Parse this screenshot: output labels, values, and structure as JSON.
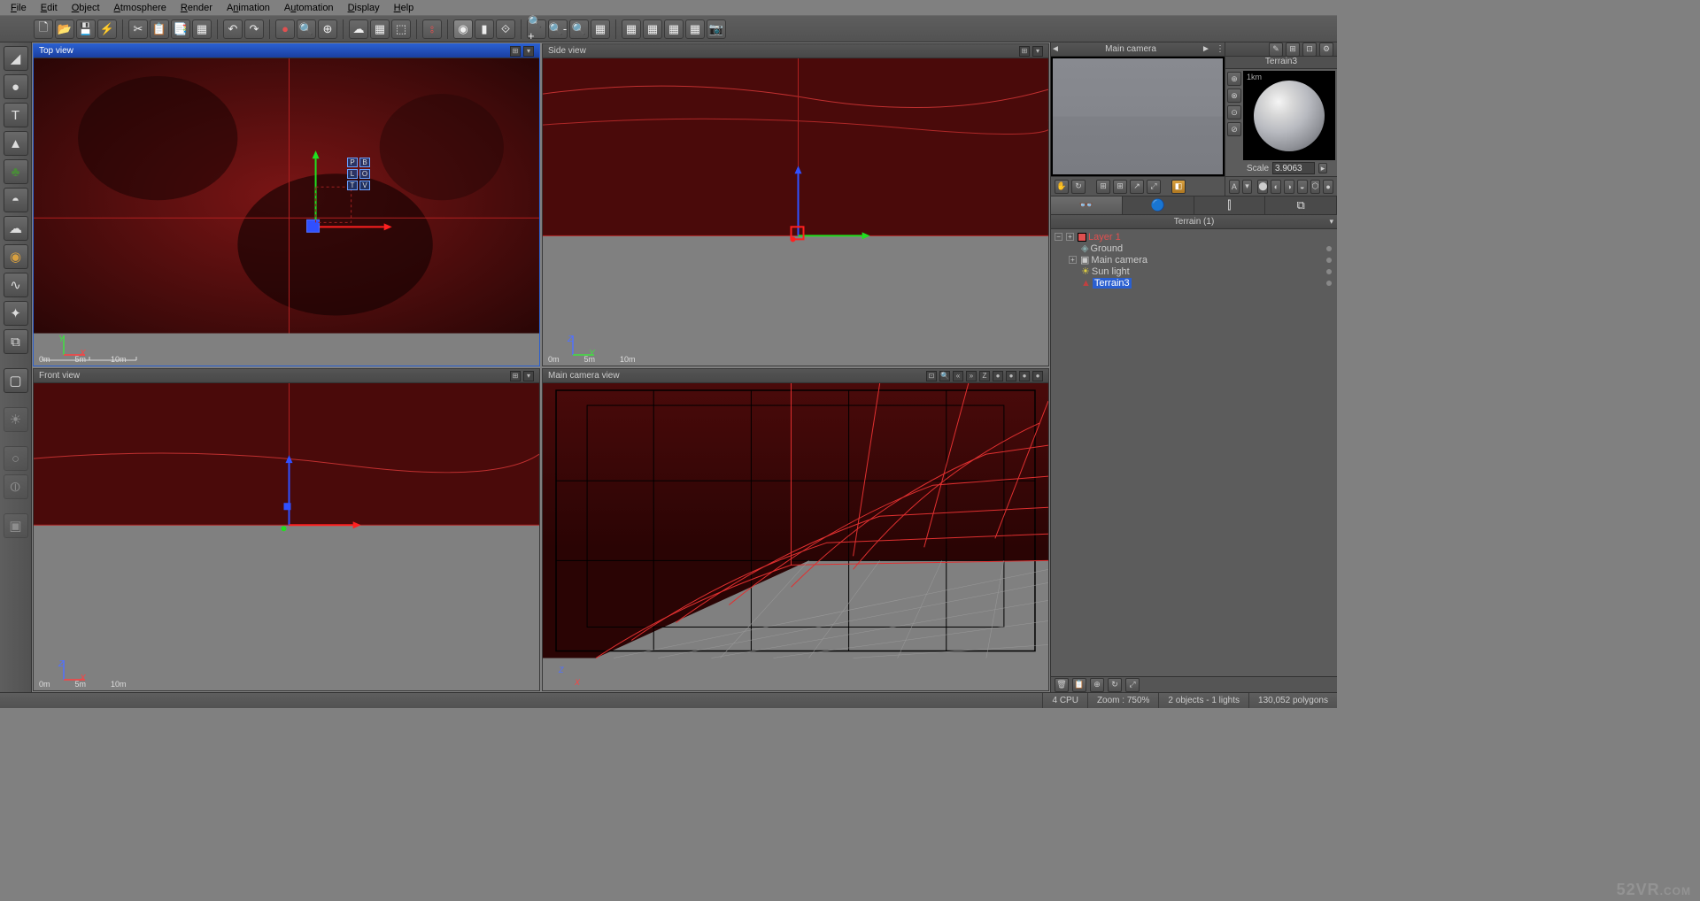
{
  "menus": [
    "File",
    "Edit",
    "Object",
    "Atmosphere",
    "Render",
    "Animation",
    "Automation",
    "Display",
    "Help"
  ],
  "viewports": {
    "top": {
      "title": "Top view",
      "axisV": "Y",
      "axisH": "X",
      "scale": [
        "0m",
        "5m",
        "10m"
      ]
    },
    "side": {
      "title": "Side view",
      "axisV": "Z",
      "axisH": "Y",
      "scale": [
        "0m",
        "5m",
        "10m"
      ]
    },
    "front": {
      "title": "Front view",
      "axisV": "Z",
      "axisH": "X",
      "scale": [
        "0m",
        "5m",
        "10m"
      ]
    },
    "camera": {
      "title": "Main camera view",
      "axisV": "Z",
      "axisH": "X"
    }
  },
  "camera_btns": [
    "«",
    "»",
    "Z",
    "●",
    "●",
    "●",
    "●"
  ],
  "preview": {
    "title": "Main camera",
    "prev": "◄",
    "next": "►"
  },
  "material": {
    "title": "Terrain3",
    "ball_label": "1km",
    "scale_label": "Scale",
    "scale_value": "3.9063"
  },
  "panel": {
    "title": "Terrain (1)"
  },
  "tree": {
    "layer": "Layer 1",
    "items": [
      {
        "label": "Ground",
        "indent": 1,
        "icon": "◈"
      },
      {
        "label": "Main camera",
        "indent": 1,
        "icon": "▣",
        "exp": "+"
      },
      {
        "label": "Sun light",
        "indent": 2,
        "icon": "☀"
      },
      {
        "label": "Terrain3",
        "indent": 2,
        "icon": "▲",
        "selected": true
      }
    ]
  },
  "status": {
    "cpu": "4 CPU",
    "zoom": "Zoom : 750%",
    "objects": "2 objects - 1 lights",
    "polys": "130,052 polygons"
  },
  "watermark": "52VR",
  "watermark_suffix": ".COM",
  "left_tool_icons": [
    "◢",
    "●",
    "T",
    "▲",
    "♣",
    "◓",
    "☁",
    "◉",
    "∿",
    "✦",
    "⧉",
    "",
    "▢",
    "",
    "☀",
    "",
    "○",
    "⦶",
    "",
    "▣"
  ],
  "toolbar_groups": [
    [
      "🗋",
      "📂",
      "💾",
      "⚡"
    ],
    [
      "✂",
      "📋",
      "📑",
      "▦"
    ],
    [
      "↶",
      "↷"
    ],
    [
      "●",
      "🔍",
      "⊕"
    ],
    [
      "☁",
      "▦",
      "⬚"
    ],
    [
      "⦂"
    ],
    [
      "◉",
      "▮",
      "⟐"
    ],
    [
      "🔍+",
      "🔍-",
      "🔍",
      "▦"
    ],
    [
      "▦",
      "▦",
      "▦",
      "▦",
      "📷"
    ]
  ],
  "preview_bottom_icons": [
    "✋",
    "↻",
    "",
    "⊞",
    "⊞",
    "↗",
    "⤢",
    "",
    "◧"
  ],
  "mat_side_icons": [
    "⊕",
    "⊗",
    "⊙",
    "⊘"
  ],
  "mat_tool_icons": [
    "✎",
    "⊞",
    "⊡",
    "⚙"
  ],
  "mat_bottom": {
    "A": "A",
    "dd": "▾",
    "icons": [
      "⬤",
      "◐",
      "◑",
      "◒",
      "⬡",
      "●"
    ]
  },
  "tab_icons": [
    "👓",
    "🔵",
    "⫿",
    "⧉"
  ],
  "tree_exp_icons": [
    "−",
    "+"
  ],
  "tree_bottom_icons": [
    "🗑",
    "📋",
    "⊕",
    "↻",
    "⤢"
  ]
}
